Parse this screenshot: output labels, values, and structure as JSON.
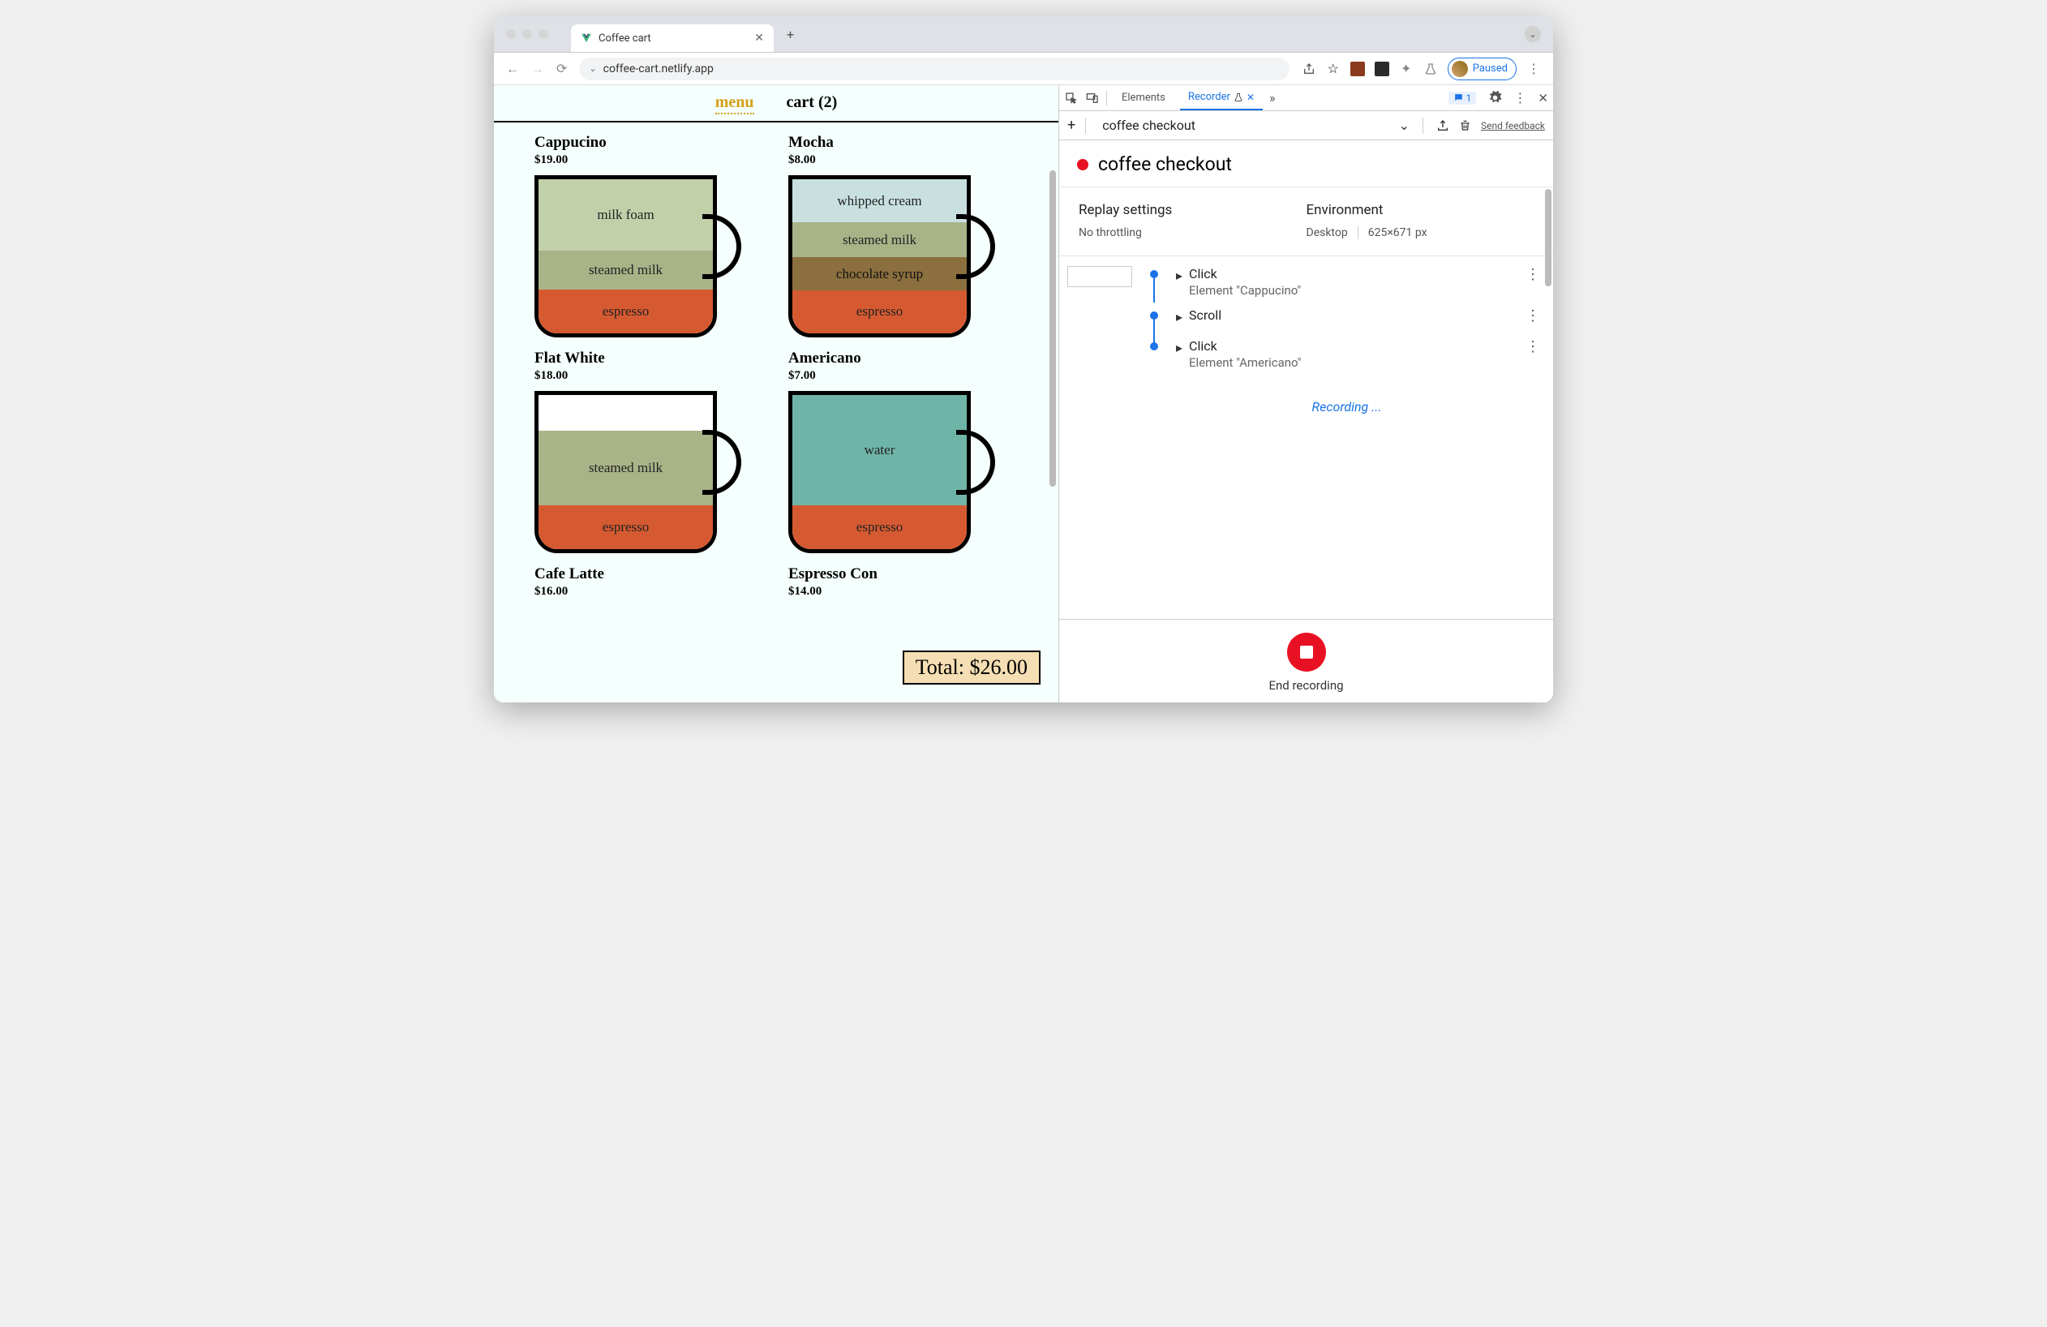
{
  "browser": {
    "tab_title": "Coffee cart",
    "url": "coffee-cart.netlify.app",
    "paused_label": "Paused"
  },
  "app": {
    "nav": {
      "menu": "menu",
      "cart": "cart (2)"
    },
    "products": [
      {
        "name": "Cappucino",
        "price": "$19.00",
        "layers": [
          {
            "label": "espresso",
            "class": "l-espresso",
            "h": 55
          },
          {
            "label": "steamed milk",
            "class": "l-steamed",
            "h": 50
          },
          {
            "label": "milk foam",
            "class": "l-foam",
            "h": 90
          }
        ]
      },
      {
        "name": "Mocha",
        "price": "$8.00",
        "layers": [
          {
            "label": "espresso",
            "class": "l-espresso",
            "h": 55
          },
          {
            "label": "chocolate syrup",
            "class": "l-choc",
            "h": 42
          },
          {
            "label": "steamed milk",
            "class": "l-steamed",
            "h": 45
          },
          {
            "label": "whipped cream",
            "class": "l-cream",
            "h": 55
          }
        ]
      },
      {
        "name": "Flat White",
        "price": "$18.00",
        "layers": [
          {
            "label": "espresso",
            "class": "l-espresso",
            "h": 55
          },
          {
            "label": "steamed milk",
            "class": "l-steamed",
            "h": 95
          },
          {
            "label": "",
            "class": "l-none",
            "h": 45
          }
        ]
      },
      {
        "name": "Americano",
        "price": "$7.00",
        "layers": [
          {
            "label": "espresso",
            "class": "l-espresso",
            "h": 55
          },
          {
            "label": "water",
            "class": "l-water",
            "h": 140
          }
        ]
      },
      {
        "name": "Cafe Latte",
        "price": "$16.00",
        "layers": []
      },
      {
        "name": "Espresso Con",
        "price": "$14.00",
        "layers": []
      }
    ],
    "total": "Total: $26.00"
  },
  "devtools": {
    "tabs": {
      "elements": "Elements",
      "recorder": "Recorder"
    },
    "messages_count": "1",
    "toolbar": {
      "recording_name": "coffee checkout",
      "feedback": "Send feedback"
    },
    "recording_title": "coffee checkout",
    "settings": {
      "replay_label": "Replay settings",
      "replay_value": "No throttling",
      "env_label": "Environment",
      "env_device": "Desktop",
      "env_size": "625×671 px"
    },
    "steps": [
      {
        "title": "Click",
        "sub": "Element \"Cappucino\"",
        "thumb": true,
        "partial": true
      },
      {
        "title": "Scroll",
        "sub": ""
      },
      {
        "title": "Click",
        "sub": "Element \"Americano\""
      }
    ],
    "recording_status": "Recording ...",
    "end_label": "End recording"
  }
}
